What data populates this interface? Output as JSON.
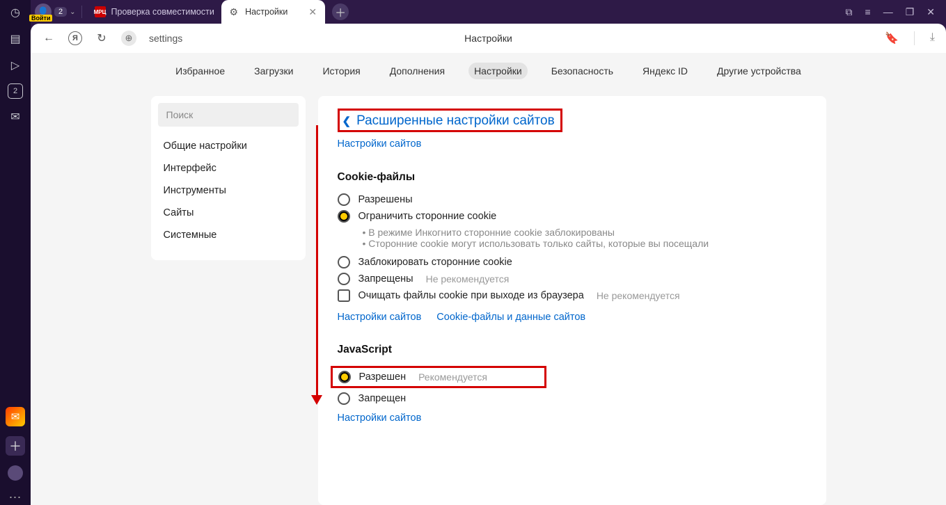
{
  "os_sidebar": {
    "login_label": "Войти",
    "badge_count": "2"
  },
  "titlebar": {
    "login_label": "Войти",
    "count_chip": "2",
    "tab1": {
      "favicon_text": "МРЦ",
      "title": "Проверка совместимости"
    },
    "tab2": {
      "title": "Настройки"
    }
  },
  "addressbar": {
    "url": "settings",
    "page_title": "Настройки"
  },
  "settings_nav": {
    "items": [
      "Избранное",
      "Загрузки",
      "История",
      "Дополнения",
      "Настройки",
      "Безопасность",
      "Яндекс ID",
      "Другие устройства"
    ],
    "active_index": 4
  },
  "side": {
    "search_placeholder": "Поиск",
    "items": [
      "Общие настройки",
      "Интерфейс",
      "Инструменты",
      "Сайты",
      "Системные"
    ]
  },
  "main": {
    "back_crumb": "Расширенные настройки сайтов",
    "sub_link": "Настройки сайтов",
    "cookies": {
      "title": "Cookie-файлы",
      "opt_allowed": "Разрешены",
      "opt_limit": "Ограничить сторонние cookie",
      "bullet1": "В режиме Инкогнито сторонние cookie заблокированы",
      "bullet2": "Сторонние cookie могут использовать только сайты, которые вы посещали",
      "opt_block3p": "Заблокировать сторонние cookie",
      "opt_deny": "Запрещены",
      "opt_deny_hint": "Не рекомендуется",
      "chk_clear": "Очищать файлы cookie при выходе из браузера",
      "chk_clear_hint": "Не рекомендуется",
      "link1": "Настройки сайтов",
      "link2": "Cookie-файлы и данные сайтов"
    },
    "js": {
      "title": "JavaScript",
      "opt_allow": "Разрешен",
      "opt_allow_hint": "Рекомендуется",
      "opt_deny": "Запрещен",
      "link": "Настройки сайтов"
    }
  }
}
